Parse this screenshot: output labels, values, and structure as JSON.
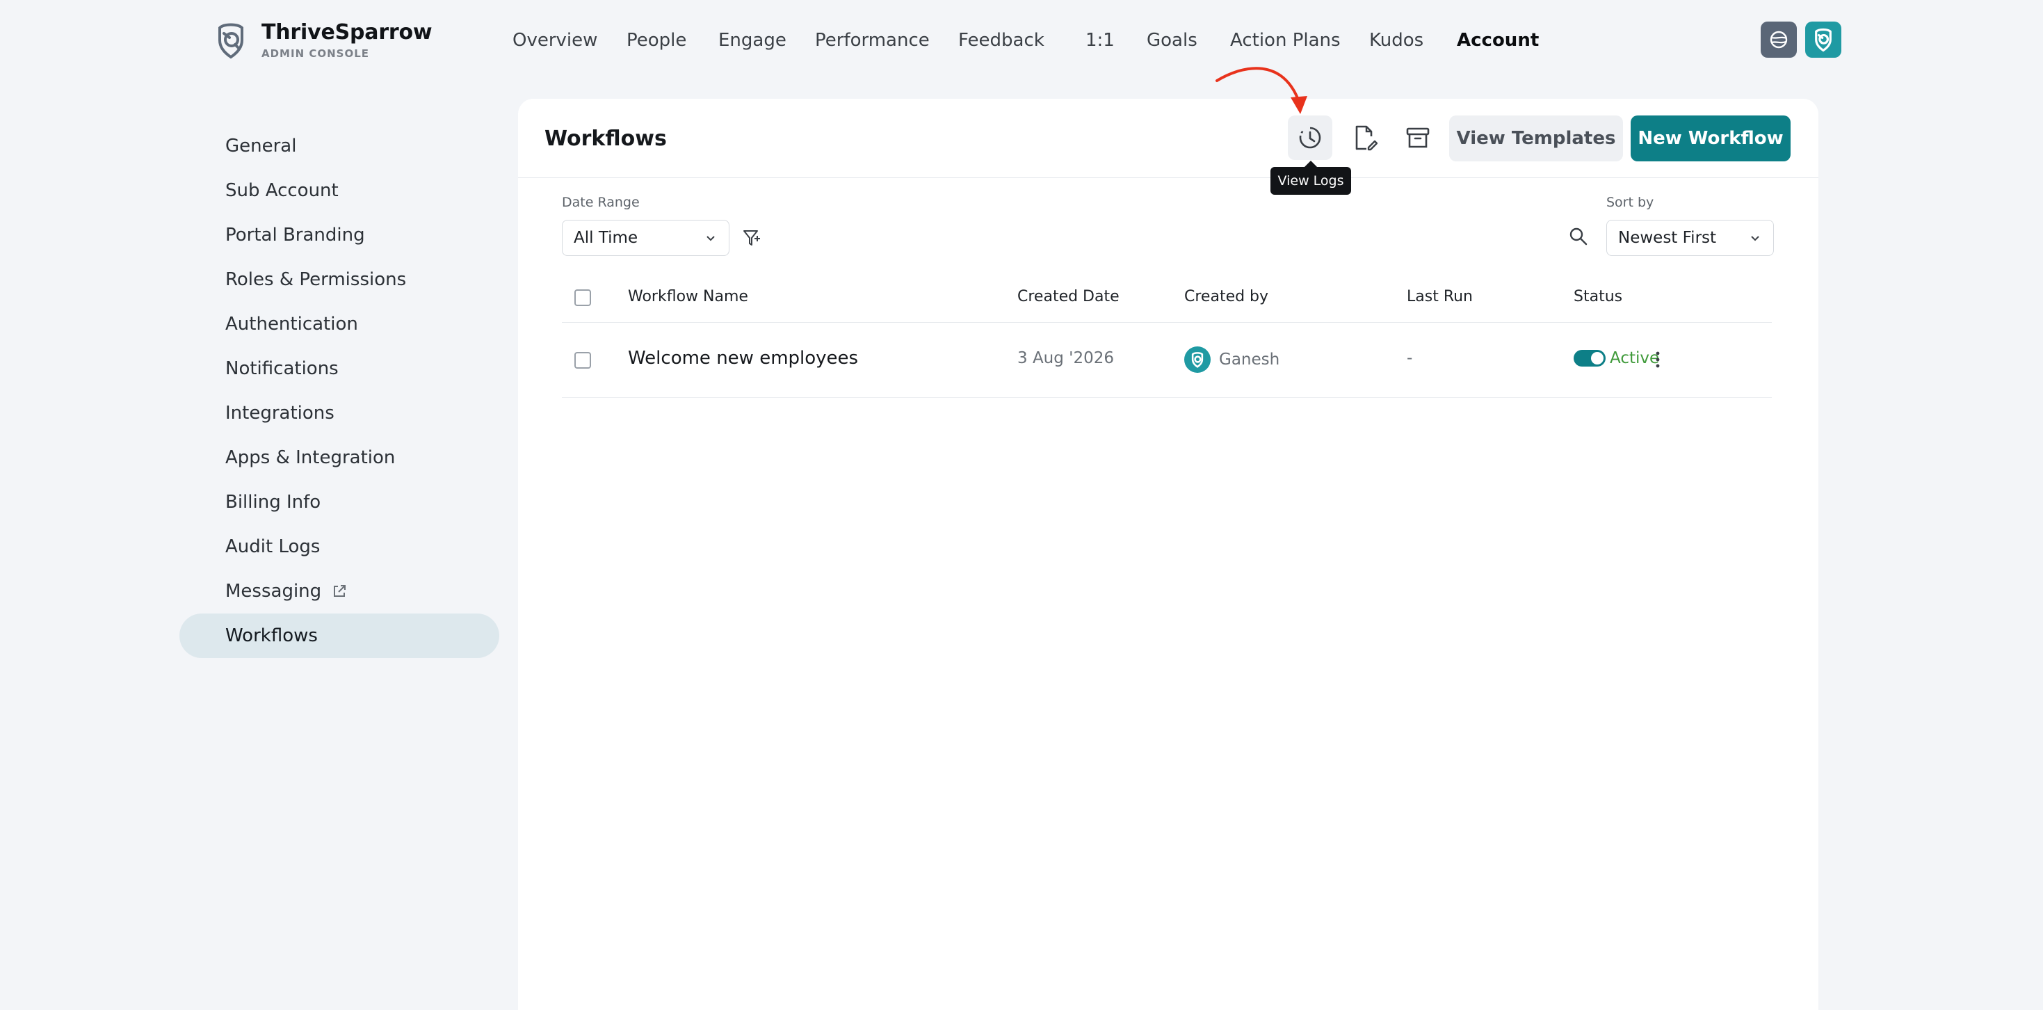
{
  "brand": {
    "name": "ThriveSparrow",
    "subtitle": "ADMIN CONSOLE"
  },
  "nav": {
    "items": [
      {
        "label": "Overview",
        "active": false
      },
      {
        "label": "People",
        "active": false
      },
      {
        "label": "Engage",
        "active": false
      },
      {
        "label": "Performance",
        "active": false
      },
      {
        "label": "Feedback",
        "active": false
      },
      {
        "label": "1:1",
        "active": false
      },
      {
        "label": "Goals",
        "active": false
      },
      {
        "label": "Action Plans",
        "active": false
      },
      {
        "label": "Kudos",
        "active": false
      },
      {
        "label": "Account",
        "active": true
      }
    ]
  },
  "sidebar": {
    "items": [
      {
        "label": "General"
      },
      {
        "label": "Sub Account"
      },
      {
        "label": "Portal Branding"
      },
      {
        "label": "Roles & Permissions"
      },
      {
        "label": "Authentication"
      },
      {
        "label": "Notifications"
      },
      {
        "label": "Integrations"
      },
      {
        "label": "Apps & Integration"
      },
      {
        "label": "Billing Info"
      },
      {
        "label": "Audit Logs"
      },
      {
        "label": "Messaging"
      },
      {
        "label": "Workflows"
      }
    ],
    "active_item": "Workflows"
  },
  "page": {
    "title": "Workflows",
    "tooltip": "View Logs",
    "view_templates_label": "View Templates",
    "new_workflow_label": "New Workflow"
  },
  "filters": {
    "date_range_label": "Date Range",
    "date_range_value": "All Time",
    "sort_label": "Sort by",
    "sort_value": "Newest First"
  },
  "table": {
    "columns": [
      "Workflow Name",
      "Created Date",
      "Created by",
      "Last Run",
      "Status"
    ],
    "rows": [
      {
        "name": "Welcome new employees",
        "created_date": "3 Aug '2026",
        "created_by": "Ganesh",
        "last_run": "-",
        "status": "Active"
      }
    ]
  },
  "colors": {
    "accent": "#0d7f87",
    "active_status": "#3f9a3a",
    "annotation_arrow": "#e8321c",
    "sidebar_active_bg": "#dde8ed"
  },
  "icons": {
    "logs": "history-clock-icon",
    "edit": "document-edit-icon",
    "archive": "archive-box-icon",
    "filter": "filter-funnel-icon",
    "search": "search-icon",
    "globe": "globe-icon",
    "more": "more-vertical-icon"
  }
}
